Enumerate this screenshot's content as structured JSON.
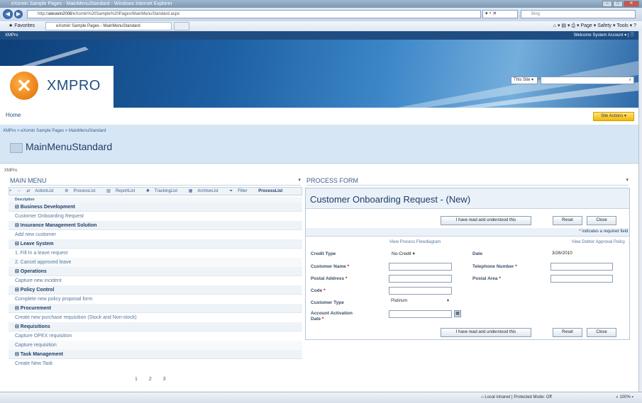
{
  "browser": {
    "title": "eXomin Sample Pages - MainMenuStandard - Windows Internet Explorer",
    "url_prefix": "http://",
    "url_host": "aleswin2008",
    "url_path": "/eXomin%20Sample%20Pages/MainMenuStandard.aspx",
    "search_placeholder": "Bing",
    "favorites_label": "Favorites",
    "tab_label": "eXomin Sample Pages - MainMenuStandard",
    "commands": "Page ▾   Safety ▾   Tools ▾",
    "status_zone": "Local intranet | Protected Mode: Off",
    "zoom": "100%"
  },
  "sharepoint": {
    "top_left": "XMPro",
    "welcome": "Welcome System Account ▾ |",
    "scope": "This Site ▾",
    "logo_text": "XMPRO",
    "home": "Home",
    "site_actions": "Site Actions ▾",
    "breadcrumb": "XMPro > eXomin Sample Pages > MainMenuStandard",
    "page_title": "MainMenuStandard",
    "zone_label": "XMPro"
  },
  "main_menu": {
    "title": "MAIN MENU",
    "toolbar": {
      "expand": "+",
      "collapse": "−",
      "items": [
        "ActionList",
        "ProcessList",
        "ReportList",
        "TrackingList",
        "ArchiveList",
        "Filter"
      ],
      "current": "ProcessList"
    },
    "description_header": "Description",
    "rows": [
      {
        "type": "grp",
        "text": "⊟ Business Development"
      },
      {
        "type": "item",
        "text": "Customer Onboarding Request"
      },
      {
        "type": "grp",
        "text": "⊟ Insurance Management Solution"
      },
      {
        "type": "item",
        "text": "Add new customer"
      },
      {
        "type": "grp",
        "text": "⊟ Leave System"
      },
      {
        "type": "item",
        "text": "1. Fill In a leave request"
      },
      {
        "type": "item",
        "text": "2. Cancel approved leave"
      },
      {
        "type": "grp",
        "text": "⊟ Operations"
      },
      {
        "type": "item",
        "text": "Capture new incident"
      },
      {
        "type": "grp",
        "text": "⊟ Policy Control"
      },
      {
        "type": "item",
        "text": "Complete new policy proposal form"
      },
      {
        "type": "grp",
        "text": "⊟ Procurement"
      },
      {
        "type": "item",
        "text": "Create new purchase requisition (Stock and Non-stock)"
      },
      {
        "type": "grp",
        "text": "⊟ Requisitions"
      },
      {
        "type": "item",
        "text": "Capture OPEX requisition"
      },
      {
        "type": "item",
        "text": "Capture requisition"
      },
      {
        "type": "grp",
        "text": "⊟ Task Management"
      },
      {
        "type": "item",
        "text": "Create New Task"
      }
    ],
    "pager": "1 2 3"
  },
  "process_form": {
    "header": "PROCESS FORM",
    "title": "Customer Onboarding Request - (New)",
    "buttons": {
      "understood": "I have read and understood this",
      "reset": "Reset",
      "close": "Close"
    },
    "required_note_star": "*",
    "required_note": "indicates a required field",
    "link_flow": "View Process Flowdiagram",
    "link_policy": "View Debtor Approval Policy",
    "fields": {
      "credit_type_label": "Credit Type",
      "credit_type_value": "No-Credit ▾",
      "date_label": "Date",
      "date_value": "3/26/2010",
      "customer_name_label": "Customer Name",
      "telephone_label": "Telephone Number",
      "postal_address_label": "Postal Address",
      "postal_area_label": "Postal Area",
      "code_label": "Code",
      "customer_type_label": "Customer Type",
      "customer_type_value": "Platinum",
      "activation_label_1": "Account Activation",
      "activation_label_2": "Date",
      "star": "*"
    }
  }
}
